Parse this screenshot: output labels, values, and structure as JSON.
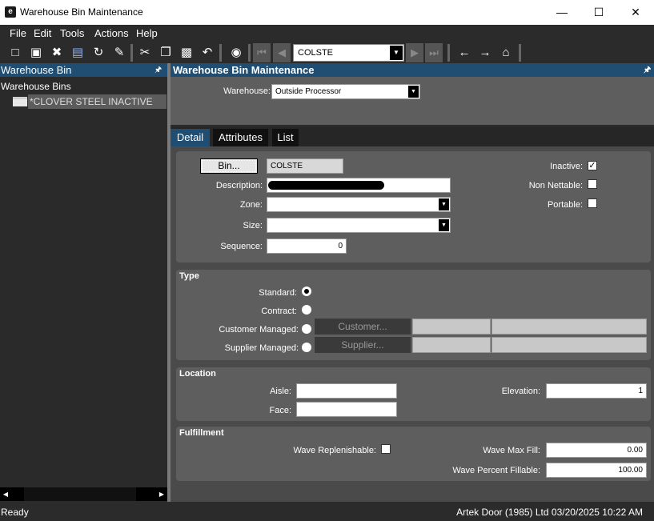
{
  "window": {
    "title": "Warehouse Bin Maintenance",
    "minimize": "—",
    "maximize": "☐",
    "close": "✕",
    "logo": "e"
  },
  "menu": [
    "File",
    "Edit",
    "Tools",
    "Actions",
    "Help"
  ],
  "toolbar": {
    "icons": [
      "new-document-icon",
      "save-icon",
      "delete-icon",
      "clipboard-check-icon",
      "refresh-icon",
      "clear-icon",
      "cut-icon",
      "copy-icon",
      "paste-icon",
      "undo-icon",
      "binoculars-icon",
      "first-record-icon",
      "previous-record-icon",
      "next-record-icon",
      "last-record-icon",
      "back-icon",
      "forward-icon",
      "home-icon"
    ],
    "record_value": "COLSTE"
  },
  "left_panel": {
    "header": "Warehouse Bin",
    "tree_root": "Warehouse Bins",
    "tree_node": "*CLOVER STEEL INACTIVE"
  },
  "right_panel": {
    "header": "Warehouse Bin Maintenance",
    "warehouse_label": "Warehouse:",
    "warehouse_value": "Outside Processor",
    "tabs": [
      "Detail",
      "Attributes",
      "List"
    ],
    "active_tab": "Detail"
  },
  "detail": {
    "bin_button": "Bin...",
    "bin_value": "COLSTE",
    "description_label": "Description:",
    "zone_label": "Zone:",
    "zone_value": "",
    "size_label": "Size:",
    "size_value": "",
    "sequence_label": "Sequence:",
    "sequence_value": "0",
    "inactive_label": "Inactive:",
    "inactive_checked": true,
    "non_nettable_label": "Non Nettable:",
    "non_nettable_checked": false,
    "portable_label": "Portable:",
    "portable_checked": false
  },
  "type_group": {
    "title": "Type",
    "standard_label": "Standard:",
    "contract_label": "Contract:",
    "customer_managed_label": "Customer Managed:",
    "supplier_managed_label": "Supplier Managed:",
    "selected": "Standard",
    "customer_button": "Customer...",
    "supplier_button": "Supplier..."
  },
  "location_group": {
    "title": "Location",
    "aisle_label": "Aisle:",
    "aisle_value": "",
    "face_label": "Face:",
    "face_value": "",
    "elevation_label": "Elevation:",
    "elevation_value": "1"
  },
  "fulfillment_group": {
    "title": "Fulfillment",
    "wave_replenishable_label": "Wave Replenishable:",
    "wave_replenishable_checked": false,
    "wave_max_fill_label": "Wave Max Fill:",
    "wave_max_fill_value": "0.00",
    "wave_percent_fillable_label": "Wave Percent Fillable:",
    "wave_percent_fillable_value": "100.00"
  },
  "status": {
    "left": "Ready",
    "right": "Artek Door (1985) Ltd  03/20/2025   10:22 AM"
  },
  "colors": {
    "header_blue": "#1f4e72",
    "background": "#2b2b2b",
    "group_gray": "#5e5e5e"
  }
}
